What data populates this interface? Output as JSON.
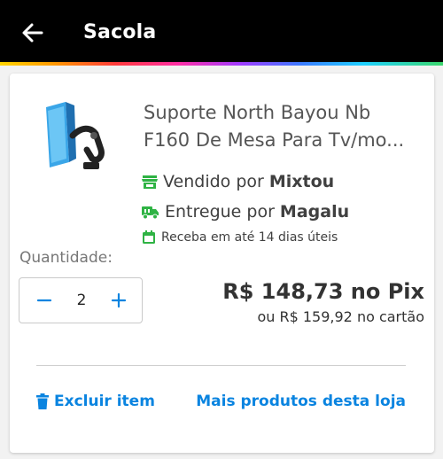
{
  "header": {
    "title": "Sacola",
    "back_icon": "arrow-left-icon",
    "background": "#000000"
  },
  "product": {
    "name_line1": "Suporte North Bayou Nb",
    "name_line2": "F160 De Mesa Para Tv/mo...",
    "image_icon": "monitor-arm-image",
    "seller_prefix": "Vendido por",
    "seller_name": "Mixtou",
    "delivery_prefix": "Entregue por",
    "delivery_name": "Magalu",
    "delivery_estimate": "Receba em até 14 dias úteis",
    "accent_green": "#2fb344"
  },
  "quantity": {
    "label": "Quantidade:",
    "value": "2",
    "decrement_icon": "minus-icon",
    "increment_icon": "plus-icon"
  },
  "pricing": {
    "pix_price": "R$ 148,73 no Pix",
    "card_price": "ou R$ 159,92 no cartão"
  },
  "actions": {
    "remove_label": "Excluir item",
    "remove_icon": "trash-icon",
    "more_products_label": "Mais produtos desta loja",
    "link_color": "#0a84e0"
  }
}
